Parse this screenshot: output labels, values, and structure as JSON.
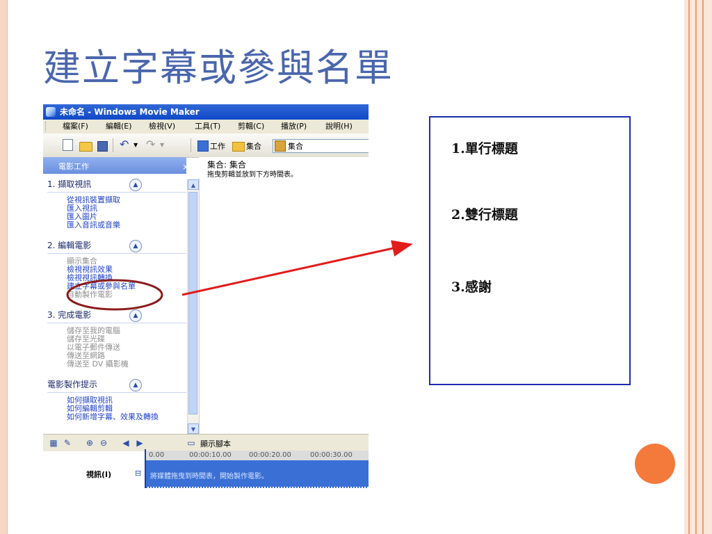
{
  "slide": {
    "title": "建立字幕或參與名單"
  },
  "colors": {
    "title": "#4a66ac",
    "arrow": "#e21b1b",
    "callout_border": "#1c2bb0",
    "accent_dot": "#f47a3c",
    "titlebar": "#1f55cf"
  },
  "app": {
    "window_title": "未命名 - Windows Movie Maker",
    "menu": [
      "檔案(F)",
      "編輯(E)",
      "檢視(V)",
      "工具(T)",
      "剪輯(C)",
      "播放(P)",
      "說明(H)"
    ],
    "toolbar": {
      "tasks_label": "工作",
      "collections_label": "集合",
      "collection_selected": "集合"
    },
    "task_pane": {
      "title": "電影工作",
      "close": "×",
      "sections": [
        {
          "title": "1. 擷取視訊",
          "links": [
            "從視訊裝置擷取",
            "匯入視訊",
            "匯入圖片",
            "匯入音訊或音樂"
          ]
        },
        {
          "title": "2. 編輯電影",
          "links": [
            "顯示集合",
            "檢視視訊效果",
            "檢視視訊轉換",
            "建立字幕或參與名單",
            "自動製作電影"
          ]
        },
        {
          "title": "3. 完成電影",
          "links": [
            "儲存至我的電腦",
            "儲存至光碟",
            "以電子郵件傳送",
            "傳送至網路",
            "傳送至 DV 攝影機"
          ]
        },
        {
          "title": "電影製作提示",
          "links": [
            "如何擷取視訊",
            "如何編輯剪輯",
            "如何新增字幕、效果及轉換"
          ]
        }
      ]
    },
    "content": {
      "header": "集合: 集合",
      "hint": "拖曳剪輯並放到下方時間表。"
    },
    "timeline": {
      "storyboard_label": "顯示腳本",
      "ruler": [
        "0.00",
        "00:00:10.00",
        "00:00:20.00",
        "00:00:30.00"
      ],
      "track_label": "視訊(I)",
      "track_placeholder": "將媒體拖曳到時間表，開始製作電影。"
    }
  },
  "callout": {
    "items": [
      "1.單行標題",
      "2.雙行標題",
      "3.感謝"
    ]
  }
}
